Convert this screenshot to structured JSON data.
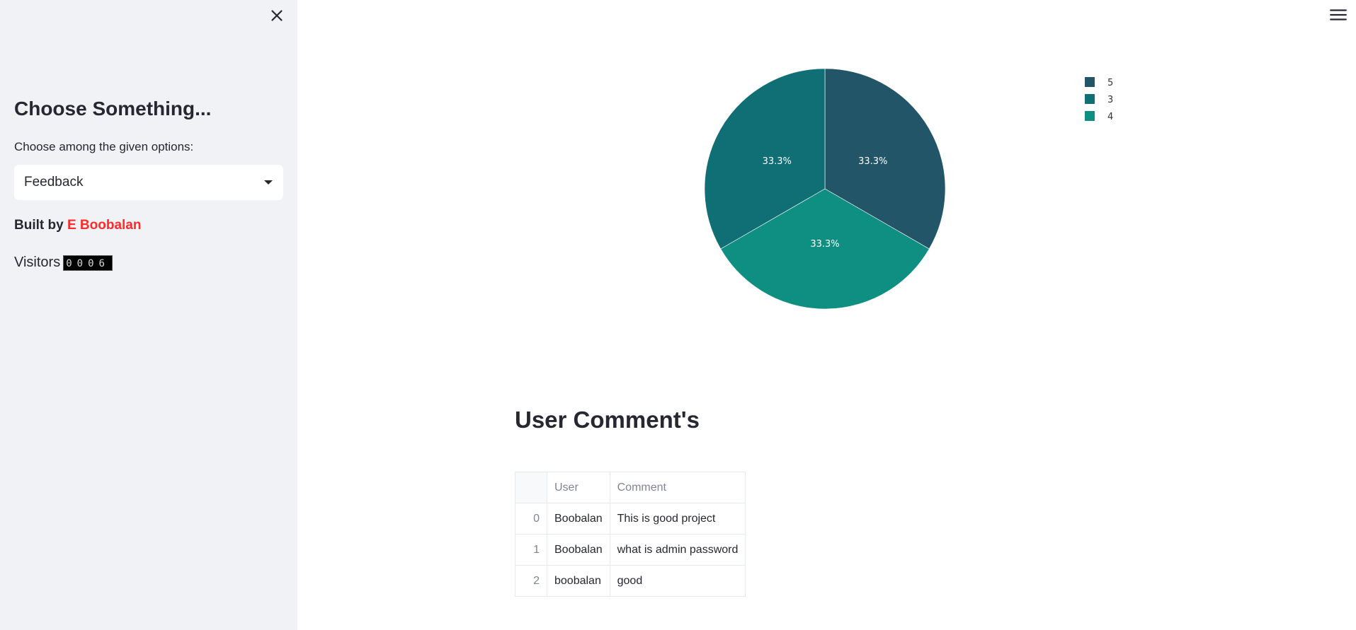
{
  "sidebar": {
    "title": "Choose Something...",
    "select_label": "Choose among the given options:",
    "selected_option": "Feedback",
    "built_by_prefix": "Built by",
    "author": "E Boobalan",
    "visitors_label": "Visitors",
    "visitor_count": "0006"
  },
  "icons": {
    "close": "close-icon",
    "menu": "hamburger-menu-icon",
    "caret": "caret-down-icon"
  },
  "colors": {
    "author_link": "#ff2b2b",
    "sidebar_bg": "#f0f2f6"
  },
  "chart_data": {
    "type": "pie",
    "slices": [
      {
        "label": "5",
        "value": 33.3,
        "text": "33.3%",
        "color": "#235568"
      },
      {
        "label": "4",
        "value": 33.3,
        "text": "33.3%",
        "color": "#0e8f81"
      },
      {
        "label": "3",
        "value": 33.3,
        "text": "33.3%",
        "color": "#106e75"
      }
    ],
    "legend": [
      "5",
      "3",
      "4"
    ],
    "legend_placement": "top-right"
  },
  "comments": {
    "title": "User Comment's",
    "columns": [
      "",
      "User",
      "Comment"
    ],
    "rows": [
      {
        "index": "0",
        "user": "Boobalan",
        "comment": "This is good project"
      },
      {
        "index": "1",
        "user": "Boobalan",
        "comment": "what is admin password"
      },
      {
        "index": "2",
        "user": "boobalan",
        "comment": "good"
      }
    ]
  }
}
